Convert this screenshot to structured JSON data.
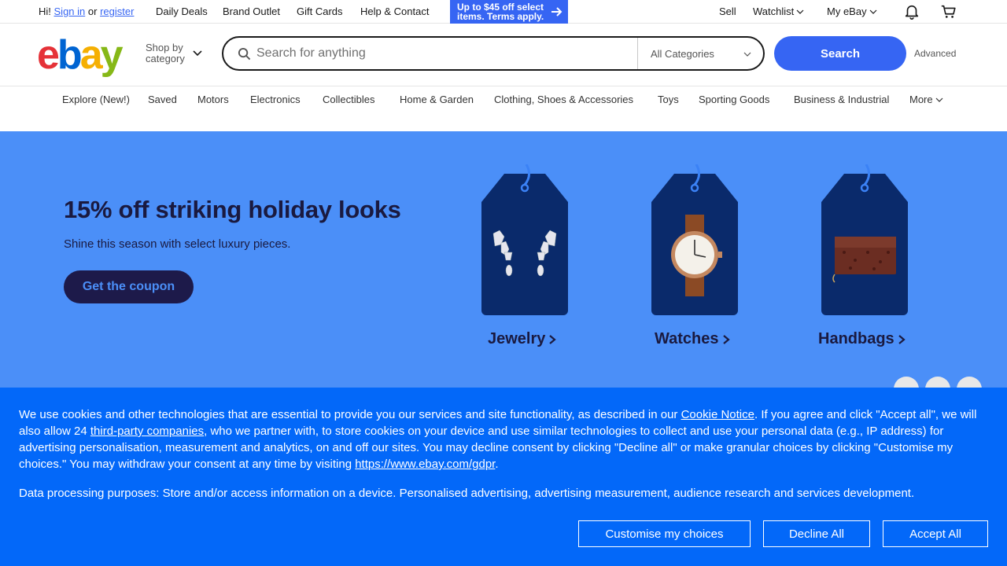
{
  "topbar": {
    "greeting": "Hi!",
    "signin": "Sign in",
    "or": "or",
    "register": "register",
    "links": [
      "Daily Deals",
      "Brand Outlet",
      "Gift Cards",
      "Help & Contact"
    ],
    "promo_line1": "Up to $45 off select",
    "promo_line2": "items. Terms apply.",
    "sell": "Sell",
    "watchlist": "Watchlist",
    "myebay": "My eBay"
  },
  "header": {
    "logo_letters": [
      "e",
      "b",
      "a",
      "y"
    ],
    "logo_colors": [
      "#e53238",
      "#0064d2",
      "#f5af02",
      "#86b817"
    ],
    "shop_by_line1": "Shop by",
    "shop_by_line2": "category",
    "search_placeholder": "Search for anything",
    "category_select": "All Categories",
    "search_button": "Search",
    "advanced": "Advanced"
  },
  "nav": {
    "items": [
      "Explore (New!)",
      "Saved",
      "Motors",
      "Electronics",
      "Collectibles",
      "Home & Garden",
      "Clothing, Shoes & Accessories",
      "Toys",
      "Sporting Goods",
      "Business & Industrial"
    ],
    "more": "More"
  },
  "hero": {
    "title": "15% off striking holiday looks",
    "subtitle": "Shine this season with select luxury pieces.",
    "cta": "Get the coupon",
    "tags": [
      "Jewelry",
      "Watches",
      "Handbags"
    ],
    "background": "#4b8ff8",
    "tag_color": "#0a2a6b"
  },
  "cookie": {
    "p1_a": "We use cookies and other technologies that are essential to provide you our services and site functionality, as described in our ",
    "p1_link1": "Cookie Notice",
    "p1_b": ". If you agree and click \"Accept all\", we will also allow 24 ",
    "p1_link2": "third-party companies",
    "p1_c": ", who we partner with, to store cookies on your device and use similar technologies to collect and use your personal data (e.g., IP address) for advertising personalisation, measurement and analytics, on and off our sites. You may decline consent by clicking \"Decline all\" or make granular choices by clicking \"Customise my choices.\" You may withdraw your consent at any time by visiting ",
    "p1_link3": "https://www.ebay.com/gdpr",
    "p1_d": ".",
    "p2": "Data processing purposes: Store and/or access information on a device. Personalised advertising, advertising measurement, audience research and services development.",
    "customise": "Customise my choices",
    "decline": "Decline All",
    "accept": "Accept All",
    "background": "#0368f9"
  }
}
